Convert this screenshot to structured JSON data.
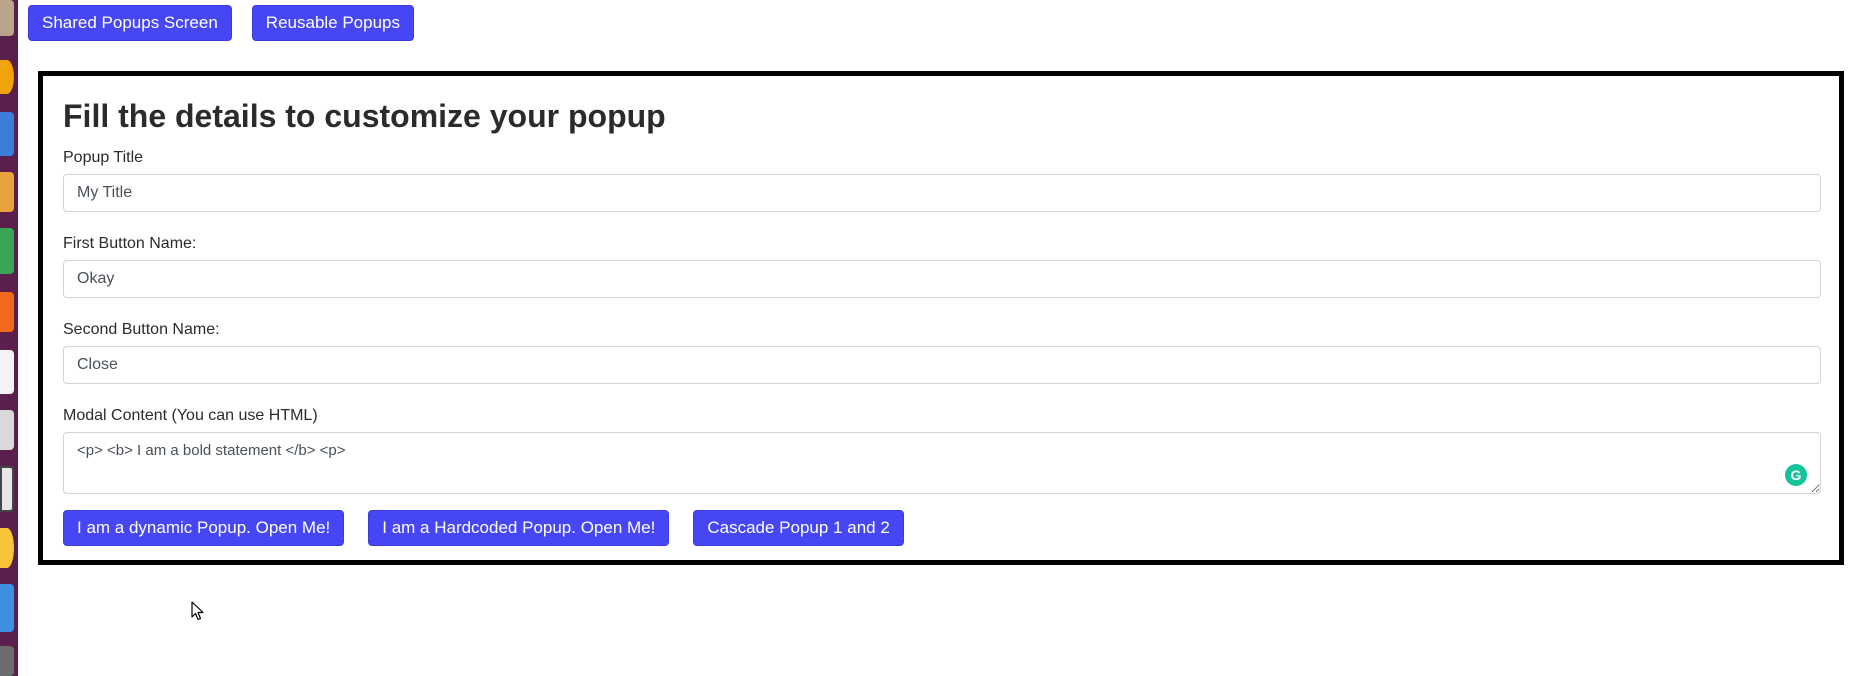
{
  "nav": {
    "shared_popups_label": "Shared Popups Screen",
    "reusable_popups_label": "Reusable Popups"
  },
  "form": {
    "heading": "Fill the details to customize your popup",
    "popup_title": {
      "label": "Popup Title",
      "value": "My Title"
    },
    "first_button": {
      "label": "First Button Name:",
      "value": "Okay"
    },
    "second_button": {
      "label": "Second Button Name:",
      "value": "Close"
    },
    "modal_content": {
      "label": "Modal Content (You can use HTML)",
      "value": "<p> <b> I am a bold statement </b> <p>"
    }
  },
  "actions": {
    "dynamic_label": "I am a dynamic Popup. Open Me!",
    "hardcoded_label": "I am a Hardcoded Popup. Open Me!",
    "cascade_label": "Cascade Popup 1 and 2"
  },
  "grammarly": {
    "glyph": "G"
  },
  "colors": {
    "accent": "#4646f5",
    "dock": "#5a1f4d",
    "border": "#000000",
    "grammarly": "#15c39a"
  }
}
